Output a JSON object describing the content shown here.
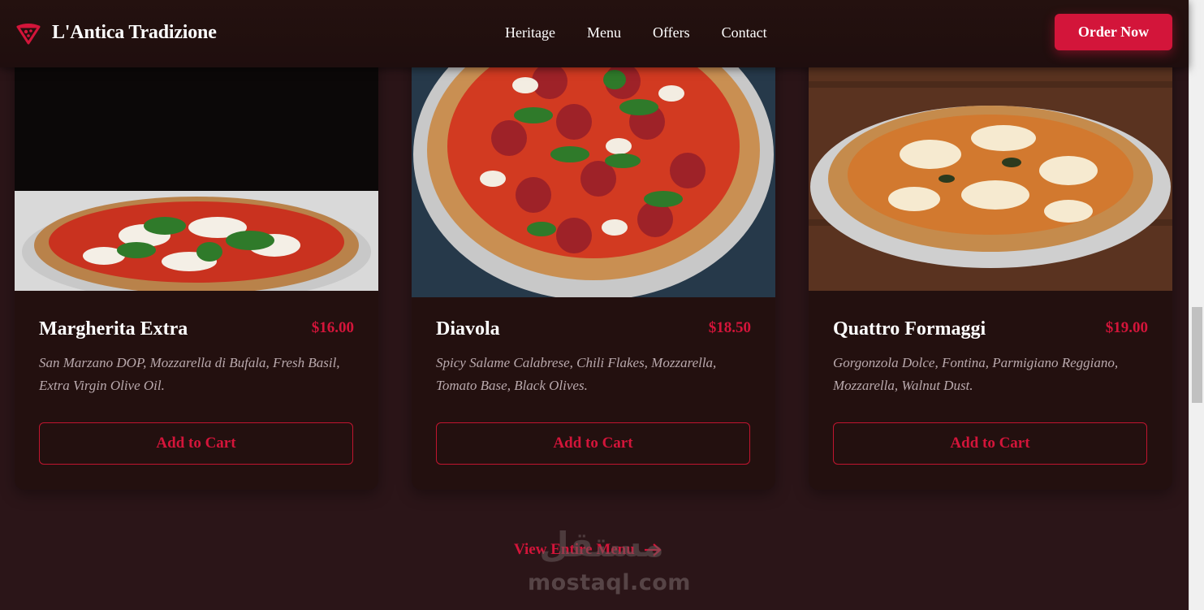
{
  "colors": {
    "accent": "#d3153a",
    "background": "#2b1518",
    "header": "#22100f",
    "card": "#23100f",
    "description": "#b9a9ad"
  },
  "header": {
    "brand_name": "L'Antica Tradizione",
    "logo_icon": "pizza-slice-icon",
    "nav": [
      "Heritage",
      "Menu",
      "Offers",
      "Contact"
    ],
    "order_button": "Order Now"
  },
  "cards": [
    {
      "title": "Margherita Extra",
      "price": "$16.00",
      "description": "San Marzano DOP, Mozzarella di Bufala, Fresh Basil, Extra Virgin Olive Oil.",
      "button": "Add to Cart"
    },
    {
      "title": "Diavola",
      "price": "$18.50",
      "description": "Spicy Salame Calabrese, Chili Flakes, Mozzarella, Tomato Base, Black Olives.",
      "button": "Add to Cart"
    },
    {
      "title": "Quattro Formaggi",
      "price": "$19.00",
      "description": "Gorgonzola Dolce, Fontina, Parmigiano Reggiano, Mozzarella, Walnut Dust.",
      "button": "Add to Cart"
    }
  ],
  "view_menu": {
    "label": "View Entire Menu",
    "icon": "arrow-right-icon"
  },
  "watermark": {
    "arabic": "مستقل",
    "latin": "mostaql.com"
  }
}
